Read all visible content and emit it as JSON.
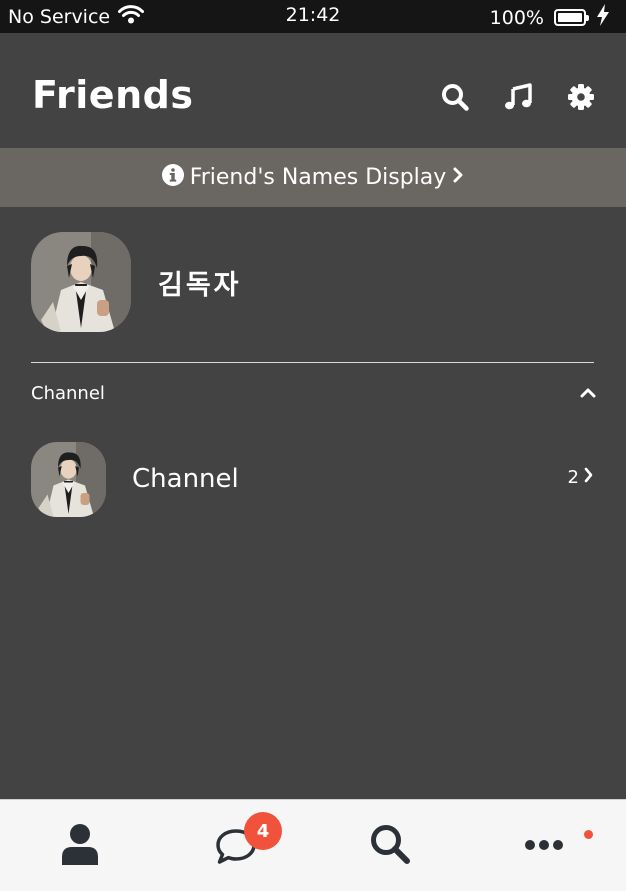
{
  "status_bar": {
    "carrier": "No Service",
    "time": "21:42",
    "battery": "100%",
    "battery_level": 1.0
  },
  "header": {
    "title": "Friends",
    "icons": [
      "search-icon",
      "music-icon",
      "gear-icon"
    ]
  },
  "banner": {
    "text": "Friend's Names Display",
    "icon": "info-icon"
  },
  "profile": {
    "name": "김독자",
    "avatar": "profile-avatar"
  },
  "channel_section": {
    "title": "Channel",
    "items": [
      {
        "label": "Channel",
        "count": "2"
      }
    ]
  },
  "tabbar": {
    "tabs": [
      {
        "name": "friends",
        "icon": "person-icon"
      },
      {
        "name": "chats",
        "icon": "chat-bubble-icon",
        "badge": "4"
      },
      {
        "name": "search",
        "icon": "search-icon"
      },
      {
        "name": "more",
        "icon": "more-icon",
        "notification_dot": true
      }
    ]
  },
  "colors": {
    "background": "#434343",
    "status_bar": "#151515",
    "banner": "#6a6661",
    "tabbar": "#f6f6f6",
    "badge": "#f0523b",
    "tab_icon": "#2c3037"
  }
}
